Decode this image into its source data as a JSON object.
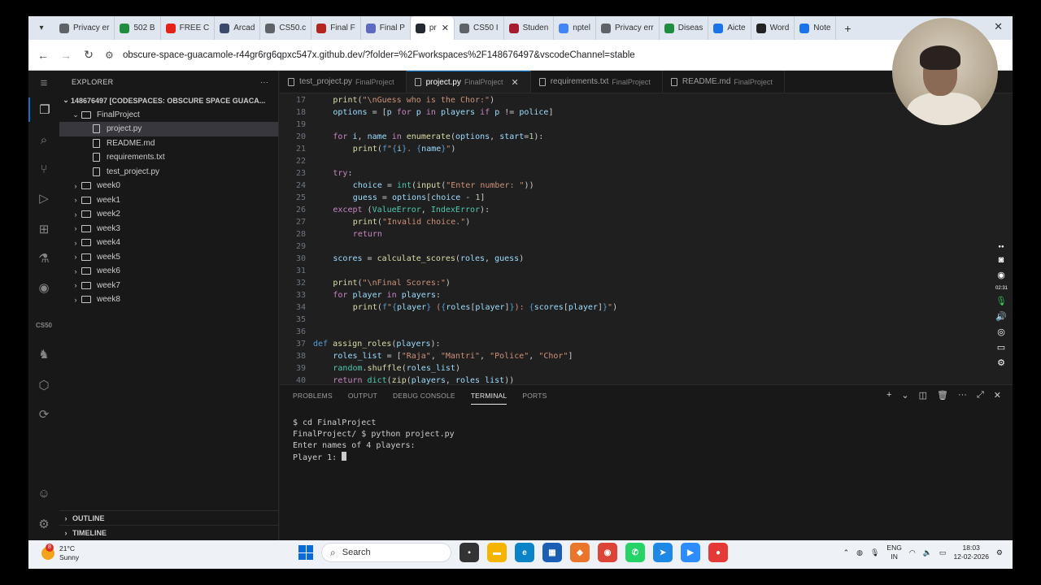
{
  "browser": {
    "tabs": [
      {
        "label": "Privacy er",
        "color": "#5f6368"
      },
      {
        "label": "502 B",
        "color": "#1e8e3e"
      },
      {
        "label": "FREE C",
        "color": "#e62117"
      },
      {
        "label": "Arcad",
        "color": "#3b4a6b"
      },
      {
        "label": "CS50.c",
        "color": "#5f6368"
      },
      {
        "label": "Final F",
        "color": "#b3261e"
      },
      {
        "label": "Final P",
        "color": "#5c6bc0"
      },
      {
        "label": "pr",
        "color": "#24292f",
        "active": true
      },
      {
        "label": "CS50 I",
        "color": "#5f6368"
      },
      {
        "label": "Studen",
        "color": "#a51c30"
      },
      {
        "label": "nptel",
        "color": "#4285f4"
      },
      {
        "label": "Privacy err",
        "color": "#5f6368"
      },
      {
        "label": "Diseas",
        "color": "#1e8e3e"
      },
      {
        "label": "Aicte",
        "color": "#1a73e8"
      },
      {
        "label": "Word",
        "color": "#222222"
      },
      {
        "label": "Note",
        "color": "#1a73e8"
      }
    ],
    "new_tab": "+",
    "close_window": "✕",
    "url": "obscure-space-guacamole-r44gr6rg6qpxc547x.github.dev/?folder=%2Fworkspaces%2F148676497&vscodeChannel=stable"
  },
  "sidebar": {
    "title": "EXPLORER",
    "more": "···",
    "root": "148676497 [CODESPACES: OBSCURE SPACE GUACA...",
    "project_folder": "FinalProject",
    "files": [
      {
        "label": "project.py",
        "selected": true
      },
      {
        "label": "README.md"
      },
      {
        "label": "requirements.txt"
      },
      {
        "label": "test_project.py"
      }
    ],
    "folders": [
      "week0",
      "week1",
      "week2",
      "week3",
      "week4",
      "week5",
      "week6",
      "week7",
      "week8"
    ],
    "outline": "OUTLINE",
    "timeline": "TIMELINE"
  },
  "activity": {
    "cs50": "CS50"
  },
  "editor": {
    "tabs": [
      {
        "name": "test_project.py",
        "dir": "FinalProject"
      },
      {
        "name": "project.py",
        "dir": "FinalProject",
        "active": true
      },
      {
        "name": "requirements.txt",
        "dir": "FinalProject"
      },
      {
        "name": "README.md",
        "dir": "FinalProject"
      }
    ],
    "lines": [
      {
        "n": "17",
        "indent": 1,
        "html": "<span style=\"color:#dcdcaa\">print</span>(<span style=\"color:#ce9178\">\"\\nGuess who is the Chor:\"</span>)"
      },
      {
        "n": "18",
        "indent": 1,
        "html": "<span style=\"color:#9cdcfe\">options</span> = [<span style=\"color:#9cdcfe\">p</span> <span style=\"color:#c586c0\">for</span> <span style=\"color:#9cdcfe\">p</span> <span style=\"color:#c586c0\">in</span> <span style=\"color:#9cdcfe\">players</span> <span style=\"color:#c586c0\">if</span> <span style=\"color:#9cdcfe\">p</span> != <span style=\"color:#9cdcfe\">police</span>]"
      },
      {
        "n": "19",
        "indent": 0,
        "html": ""
      },
      {
        "n": "20",
        "indent": 1,
        "html": "<span style=\"color:#c586c0\">for</span> <span style=\"color:#9cdcfe\">i</span>, <span style=\"color:#9cdcfe\">name</span> <span style=\"color:#c586c0\">in</span> <span style=\"color:#dcdcaa\">enumerate</span>(<span style=\"color:#9cdcfe\">options</span>, <span style=\"color:#9cdcfe\">start</span>=<span style=\"color:#b5cea8\">1</span>):"
      },
      {
        "n": "21",
        "indent": 2,
        "html": "<span style=\"color:#dcdcaa\">print</span>(<span style=\"color:#569cd6\">f</span><span style=\"color:#ce9178\">\"</span><span style=\"color:#569cd6\">{</span><span style=\"color:#9cdcfe\">i</span><span style=\"color:#569cd6\">}</span><span style=\"color:#ce9178\">. </span><span style=\"color:#569cd6\">{</span><span style=\"color:#9cdcfe\">name</span><span style=\"color:#569cd6\">}</span><span style=\"color:#ce9178\">\"</span>)"
      },
      {
        "n": "22",
        "indent": 0,
        "html": ""
      },
      {
        "n": "23",
        "indent": 1,
        "html": "<span style=\"color:#c586c0\">try</span>:"
      },
      {
        "n": "24",
        "indent": 2,
        "html": "<span style=\"color:#9cdcfe\">choice</span> = <span style=\"color:#4ec9b0\">int</span>(<span style=\"color:#dcdcaa\">input</span>(<span style=\"color:#ce9178\">\"Enter number: \"</span>))"
      },
      {
        "n": "25",
        "indent": 2,
        "html": "<span style=\"color:#9cdcfe\">guess</span> = <span style=\"color:#9cdcfe\">options</span>[<span style=\"color:#9cdcfe\">choice</span> - <span style=\"color:#b5cea8\">1</span>]"
      },
      {
        "n": "26",
        "indent": 1,
        "html": "<span style=\"color:#c586c0\">except</span> (<span style=\"color:#4ec9b0\">ValueError</span>, <span style=\"color:#4ec9b0\">IndexError</span>):"
      },
      {
        "n": "27",
        "indent": 2,
        "html": "<span style=\"color:#dcdcaa\">print</span>(<span style=\"color:#ce9178\">\"Invalid choice.\"</span>)"
      },
      {
        "n": "28",
        "indent": 2,
        "html": "<span style=\"color:#c586c0\">return</span>"
      },
      {
        "n": "29",
        "indent": 0,
        "html": ""
      },
      {
        "n": "30",
        "indent": 1,
        "html": "<span style=\"color:#9cdcfe\">scores</span> = <span style=\"color:#dcdcaa\">calculate_scores</span>(<span style=\"color:#9cdcfe\">roles</span>, <span style=\"color:#9cdcfe\">guess</span>)"
      },
      {
        "n": "31",
        "indent": 0,
        "html": ""
      },
      {
        "n": "32",
        "indent": 1,
        "html": "<span style=\"color:#dcdcaa\">print</span>(<span style=\"color:#ce9178\">\"\\nFinal Scores:\"</span>)"
      },
      {
        "n": "33",
        "indent": 1,
        "html": "<span style=\"color:#c586c0\">for</span> <span style=\"color:#9cdcfe\">player</span> <span style=\"color:#c586c0\">in</span> <span style=\"color:#9cdcfe\">players</span>:"
      },
      {
        "n": "34",
        "indent": 2,
        "html": "<span style=\"color:#dcdcaa\">print</span>(<span style=\"color:#569cd6\">f</span><span style=\"color:#ce9178\">\"</span><span style=\"color:#569cd6\">{</span><span style=\"color:#9cdcfe\">player</span><span style=\"color:#569cd6\">}</span><span style=\"color:#ce9178\"> (</span><span style=\"color:#569cd6\">{</span><span style=\"color:#9cdcfe\">roles</span>[<span style=\"color:#9cdcfe\">player</span>]<span style=\"color:#569cd6\">}</span><span style=\"color:#ce9178\">): </span><span style=\"color:#569cd6\">{</span><span style=\"color:#9cdcfe\">scores</span>[<span style=\"color:#9cdcfe\">player</span>]<span style=\"color:#569cd6\">}</span><span style=\"color:#ce9178\">\"</span>)"
      },
      {
        "n": "35",
        "indent": 0,
        "html": ""
      },
      {
        "n": "36",
        "indent": 0,
        "html": ""
      },
      {
        "n": "37",
        "indent": 0,
        "html": "<span style=\"color:#569cd6\">def</span> <span style=\"color:#dcdcaa\">assign_roles</span>(<span style=\"color:#9cdcfe\">players</span>):"
      },
      {
        "n": "38",
        "indent": 1,
        "html": "<span style=\"color:#9cdcfe\">roles_list</span> = [<span style=\"color:#ce9178\">\"Raja\"</span>, <span style=\"color:#ce9178\">\"Mantri\"</span>, <span style=\"color:#ce9178\">\"Police\"</span>, <span style=\"color:#ce9178\">\"Chor\"</span>]"
      },
      {
        "n": "39",
        "indent": 1,
        "html": "<span style=\"color:#4ec9b0\">random</span>.<span style=\"color:#dcdcaa\">shuffle</span>(<span style=\"color:#9cdcfe\">roles_list</span>)"
      },
      {
        "n": "40",
        "indent": 1,
        "html": "<span style=\"color:#c586c0\">return</span> <span style=\"color:#4ec9b0\">dict</span>(<span style=\"color:#dcdcaa\">zip</span>(<span style=\"color:#9cdcfe\">players</span>, <span style=\"color:#9cdcfe\">roles_list</span>))"
      }
    ]
  },
  "panel": {
    "tabs": [
      "PROBLEMS",
      "OUTPUT",
      "DEBUG CONSOLE",
      "TERMINAL",
      "PORTS"
    ],
    "active_tab": "TERMINAL",
    "terminal": {
      "line1": "$ cd FinalProject",
      "line2": "FinalProject/ $ python project.py",
      "line3": "Enter names of 4 players:",
      "line4": "Player 1: "
    }
  },
  "recorder": {
    "timer": "02:31"
  },
  "taskbar": {
    "temperature": "21°C",
    "weather": "Sunny",
    "weather_badge": "8",
    "search": "Search",
    "lang1": "ENG",
    "lang2": "IN",
    "time": "18:03",
    "date": "12-02-2026"
  }
}
